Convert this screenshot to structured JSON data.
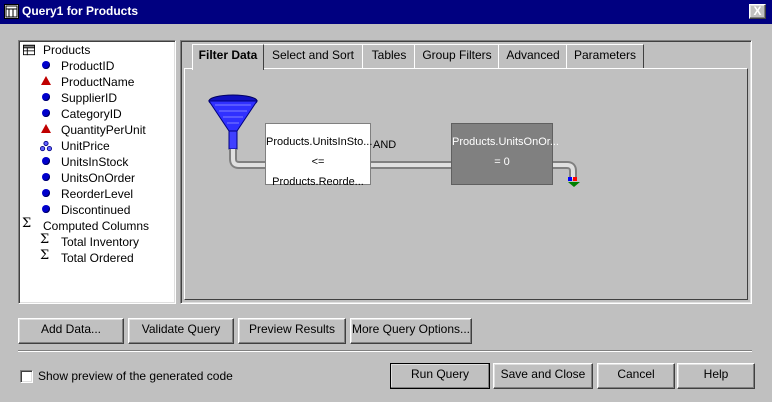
{
  "window": {
    "title": "Query1 for Products",
    "close_symbol": "X"
  },
  "tree": {
    "root": "Products",
    "fields": [
      {
        "label": "ProductID",
        "icon": "blue-dot-icon"
      },
      {
        "label": "ProductName",
        "icon": "red-triangle-icon"
      },
      {
        "label": "SupplierID",
        "icon": "blue-dot-icon"
      },
      {
        "label": "CategoryID",
        "icon": "blue-dot-icon"
      },
      {
        "label": "QuantityPerUnit",
        "icon": "red-triangle-icon"
      },
      {
        "label": "UnitPrice",
        "icon": "money-icon"
      },
      {
        "label": "UnitsInStock",
        "icon": "blue-dot-icon"
      },
      {
        "label": "UnitsOnOrder",
        "icon": "blue-dot-icon"
      },
      {
        "label": "ReorderLevel",
        "icon": "blue-dot-icon"
      },
      {
        "label": "Discontinued",
        "icon": "blue-dot-icon"
      }
    ],
    "computed_root": "Computed Columns",
    "computed": [
      {
        "label": "Total Inventory"
      },
      {
        "label": "Total Ordered"
      }
    ]
  },
  "tabs": [
    {
      "label": "Filter Data",
      "active": true
    },
    {
      "label": "Select and Sort"
    },
    {
      "label": "Tables"
    },
    {
      "label": "Group Filters"
    },
    {
      "label": "Advanced"
    },
    {
      "label": "Parameters"
    }
  ],
  "filter": {
    "box1_line1": "Products.UnitsInSto...",
    "box1_line2": "<= Products.Reorde...",
    "connector": "AND",
    "box2_line1": "Products.UnitsOnOr...",
    "box2_line2": "= 0"
  },
  "actions": {
    "add_data": "Add Data...",
    "validate": "Validate Query",
    "preview": "Preview Results",
    "more_options": "More Query Options..."
  },
  "preview_code_label": "Show preview of the generated code",
  "footer": {
    "run": "Run Query",
    "save_close": "Save and Close",
    "cancel": "Cancel",
    "help": "Help"
  }
}
